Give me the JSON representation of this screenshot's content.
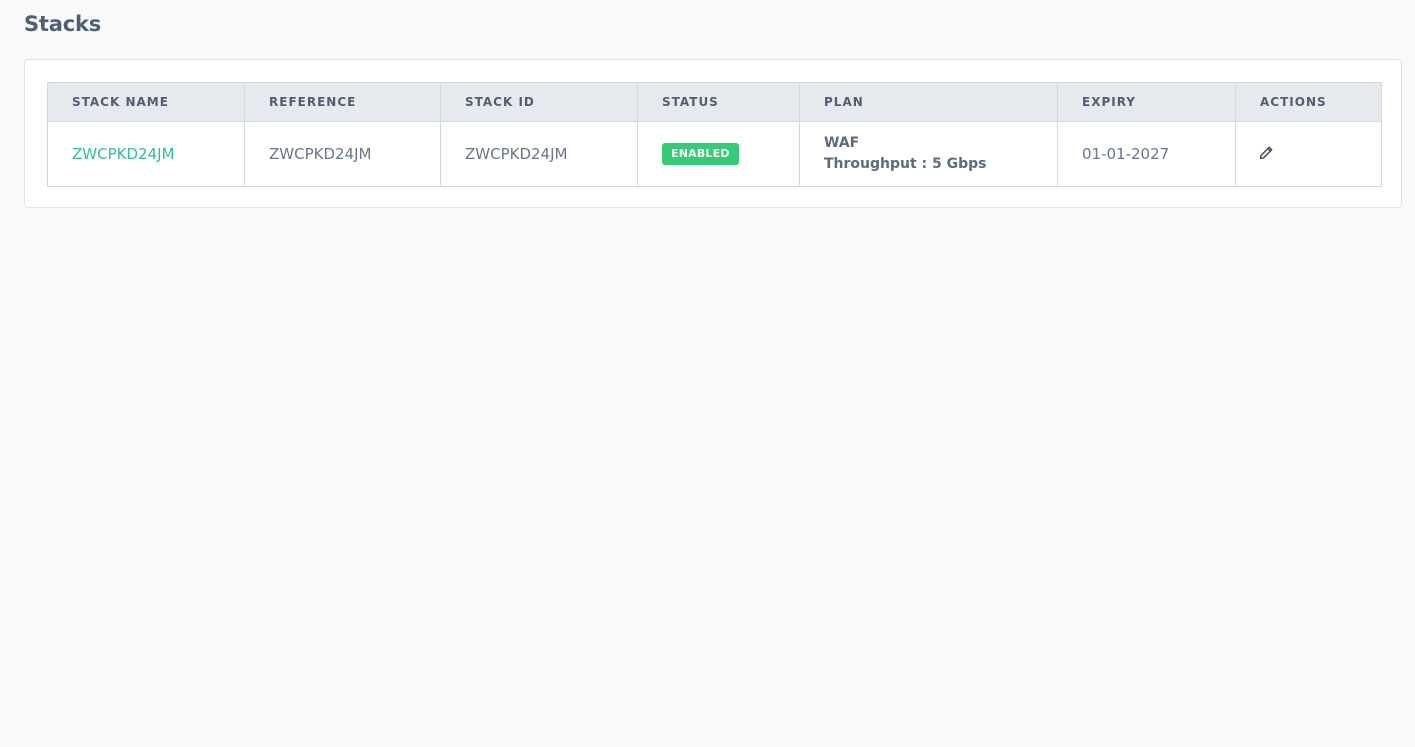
{
  "page": {
    "title": "Stacks"
  },
  "table": {
    "columns": [
      "STACK NAME",
      "REFERENCE",
      "STACK ID",
      "STATUS",
      "PLAN",
      "EXPIRY",
      "ACTIONS"
    ],
    "rows": [
      {
        "stack_name": "ZWCPKD24JM",
        "reference": "ZWCPKD24JM",
        "stack_id": "ZWCPKD24JM",
        "status": "ENABLED",
        "plan_name": "WAF",
        "plan_throughput": "Throughput : 5 Gbps",
        "expiry": "01-01-2027",
        "action_icon": "pencil-icon"
      }
    ]
  },
  "colors": {
    "link": "#2fbf9a",
    "status_enabled": "#33cc74",
    "header_bg": "#e6e9ee",
    "page_bg": "#f8f9fb"
  }
}
